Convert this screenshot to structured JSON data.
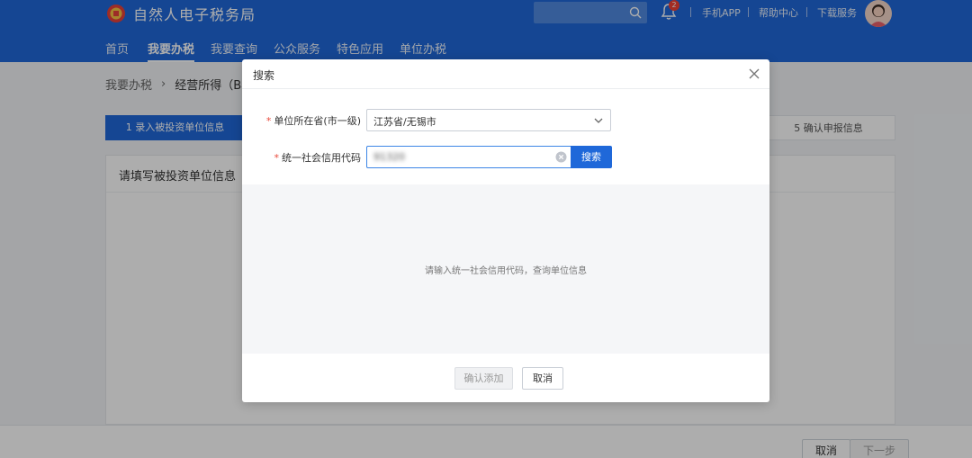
{
  "app": {
    "title": "自然人电子税务局"
  },
  "header": {
    "search_placeholder": "",
    "notification_count": "2",
    "links": [
      "手机APP",
      "帮助中心",
      "下载服务"
    ]
  },
  "nav": {
    "items": [
      "首页",
      "我要办税",
      "我要查询",
      "公众服务",
      "特色应用",
      "单位办税"
    ],
    "active_index": 1
  },
  "breadcrumb": {
    "root": "我要办税",
    "current": "经营所得（B表"
  },
  "steps": {
    "first": "1 录入被投资单位信息",
    "last": "5 确认申报信息"
  },
  "panel": {
    "title": "请填写被投资单位信息"
  },
  "footer": {
    "cancel_label": "取消",
    "next_label": "下一步"
  },
  "dialog": {
    "title": "搜索",
    "province_label": "单位所在省(市一级)",
    "province_value": "江苏省/无锡市",
    "credit_code_label": "统一社会信用代码",
    "credit_code_value": "91320",
    "search_label": "搜索",
    "empty_hint": "请输入统一社会信用代码，查询单位信息",
    "confirm_label": "确认添加",
    "cancel_label": "取消"
  },
  "colors": {
    "primary": "#1f68d9",
    "required": "#e94b3c",
    "badge": "#f04134"
  }
}
